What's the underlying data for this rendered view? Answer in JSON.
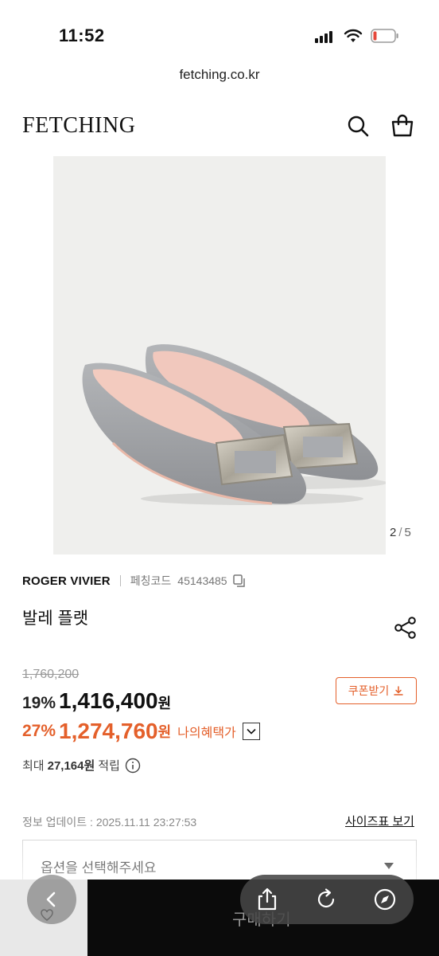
{
  "status_bar": {
    "time": "11:52",
    "icons": [
      "cellular-signal-icon",
      "wifi-icon",
      "battery-low-icon"
    ],
    "battery_color": "#e5483b"
  },
  "browser": {
    "url": "fetching.co.kr"
  },
  "header": {
    "logo": "FETCHING",
    "icons": [
      "search-icon",
      "shopping-bag-icon"
    ]
  },
  "gallery": {
    "current": "2",
    "separator": "/",
    "total": "5",
    "image_subject": "grey patent leather ballet flats with silver square buckle"
  },
  "product": {
    "brand": "ROGER VIVIER",
    "code_label": "페칭코드",
    "code": "45143485",
    "name": "발레 플랫",
    "original_price": "1,760,200",
    "sale_discount": "19%",
    "sale_price": "1,416,400",
    "currency": "원",
    "my_discount": "27%",
    "my_price": "1,274,760",
    "my_benefit_label": "나의혜택가",
    "coupon_label": "쿠폰받기",
    "points_prefix": "최대",
    "points_value": "27,164원",
    "points_suffix": "적립",
    "update_info": "정보 업데이트 : 2025.11.11 23:27:53",
    "size_chart_label": "사이즈표 보기",
    "option_placeholder": "옵션을 선택해주세요",
    "buy_label": "구매하기"
  },
  "colors": {
    "accent": "#e4602b",
    "text": "#111111",
    "muted": "#888888",
    "image_bg": "#efefed",
    "shoe_grey": "#9fa1a4"
  },
  "browser_toolbar": {
    "icons": [
      "back-icon",
      "share-icon",
      "reload-icon",
      "compass-icon"
    ]
  }
}
